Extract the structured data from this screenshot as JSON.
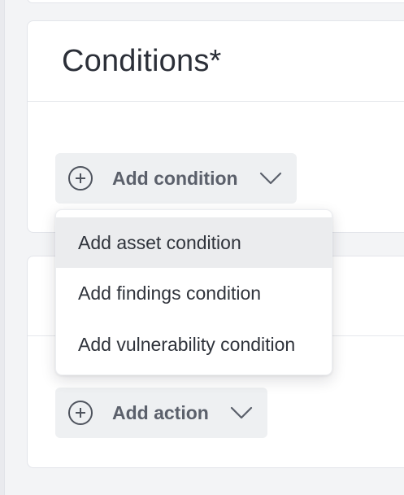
{
  "conditions": {
    "title": "Conditions*",
    "add_button_label": "Add condition",
    "menu": [
      {
        "label": "Add asset condition",
        "highlighted": true
      },
      {
        "label": "Add findings condition",
        "highlighted": false
      },
      {
        "label": "Add vulnerability condition",
        "highlighted": false
      }
    ]
  },
  "actions": {
    "add_button_label": "Add action"
  },
  "icons": {
    "add": "plus-circle-icon",
    "expand": "chevron-down-icon"
  },
  "colors": {
    "background": "#f3f4f6",
    "card": "#ffffff",
    "button_bg": "#eef0f2",
    "menu_highlight": "#ebecee",
    "text": "#2b2f38",
    "button_text": "#5b606b"
  }
}
